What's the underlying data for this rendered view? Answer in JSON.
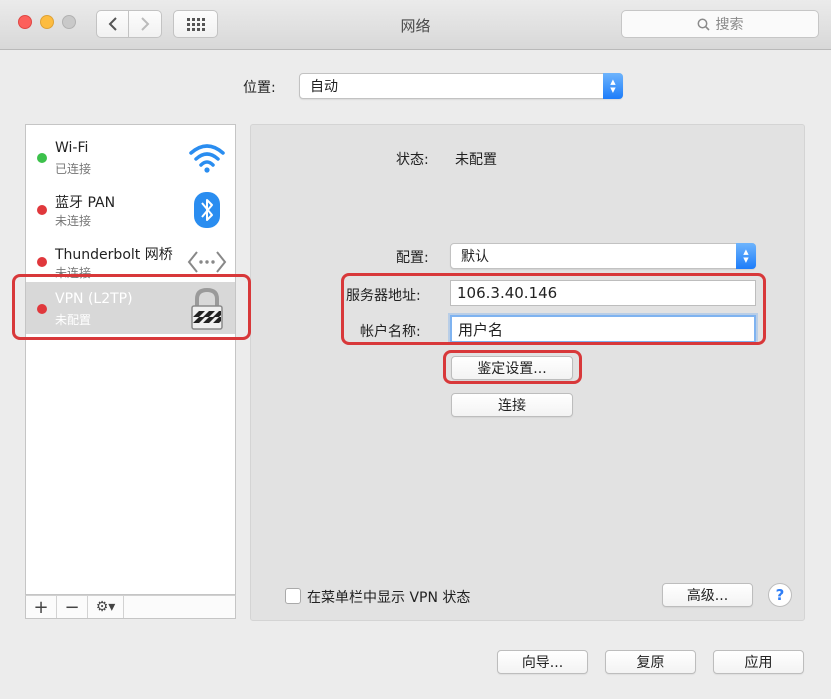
{
  "window": {
    "title": "网络"
  },
  "toolbar": {
    "search_placeholder": "搜索"
  },
  "location": {
    "label": "位置:",
    "value": "自动"
  },
  "services": [
    {
      "name": "Wi-Fi",
      "status": "已连接",
      "dot_color": "#3cc14b",
      "icon": "wifi-icon"
    },
    {
      "name": "蓝牙 PAN",
      "status": "未连接",
      "dot_color": "#e0383c",
      "icon": "bluetooth-icon"
    },
    {
      "name": "Thunderbolt 网桥",
      "status": "未连接",
      "dot_color": "#e0383c",
      "icon": "thunderbolt-bridge-icon"
    },
    {
      "name": "VPN (L2TP)",
      "status": "未配置",
      "dot_color": "#e0383c",
      "icon": "lock-icon",
      "selected": true
    }
  ],
  "list_toolbar": {
    "add": "+",
    "remove": "−",
    "gear": "⚙▾"
  },
  "detail": {
    "status_label": "状态:",
    "status_value": "未配置",
    "config_label": "配置:",
    "config_value": "默认",
    "server_label": "服务器地址:",
    "server_value": "106.3.40.146",
    "account_label": "帐户名称:",
    "account_value": "用户名",
    "auth_button": "鉴定设置...",
    "connect_button": "连接",
    "show_vpn_label": "在菜单栏中显示 VPN 状态",
    "advanced_button": "高级...",
    "help_button": "?"
  },
  "footer": {
    "assist": "向导...",
    "revert": "复原",
    "apply": "应用"
  },
  "colors": {
    "highlight": "#d8383a",
    "accent": "#1d7dfa"
  }
}
